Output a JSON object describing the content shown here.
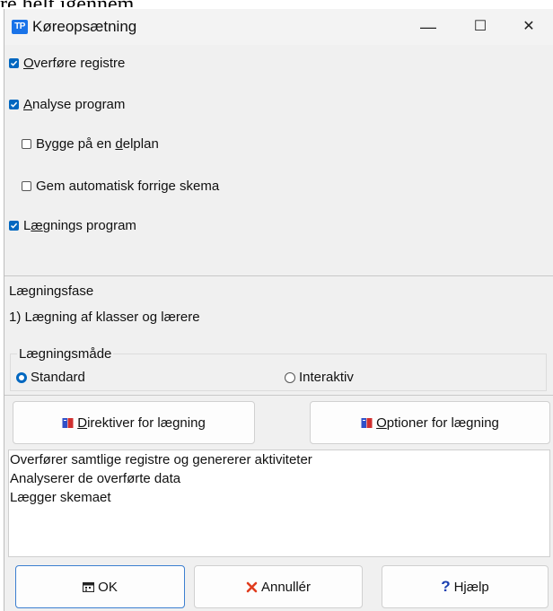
{
  "background_text": "re helt igennem.",
  "window": {
    "icon_text": "TP",
    "title": "Køreopsætning",
    "minimize": "—",
    "maximize": "☐",
    "close": "✕"
  },
  "options": {
    "overfore": {
      "pre": "",
      "u": "O",
      "post": "verføre registre",
      "checked": true
    },
    "analyse": {
      "pre": "",
      "u": "A",
      "post": "nalyse program",
      "checked": true
    },
    "bygge": {
      "pre": "Bygge på en ",
      "u": "d",
      "post": "elplan",
      "checked": false
    },
    "gem": {
      "pre": "Gem automatisk forrige skema",
      "u": "",
      "post": "",
      "checked": false
    },
    "laegning": {
      "pre": "L",
      "u": "æ",
      "post": "gnings program",
      "checked": true
    }
  },
  "phase": {
    "heading": "Lægningsfase",
    "value": "1) Lægning af klasser og lærere"
  },
  "mode": {
    "label": "Lægningsmåde",
    "standard": "Standard",
    "interaktiv": "Interaktiv",
    "selected": "Standard"
  },
  "buttons": {
    "direktiver": {
      "u": "D",
      "rest": "irektiver for lægning"
    },
    "optioner": {
      "u": "O",
      "rest": "ptioner for lægning"
    },
    "ok": "OK",
    "annuller": "Annullér",
    "hjaelp": "Hjælp"
  },
  "log": {
    "lines": [
      "Overfører samtlige registre og genererer aktiviteter",
      "Analyserer de overførte data",
      "Lægger skemaet"
    ]
  },
  "colors": {
    "accent": "#0067c0",
    "cancel_red": "#e03c1e",
    "help_blue": "#1a3fb0"
  }
}
